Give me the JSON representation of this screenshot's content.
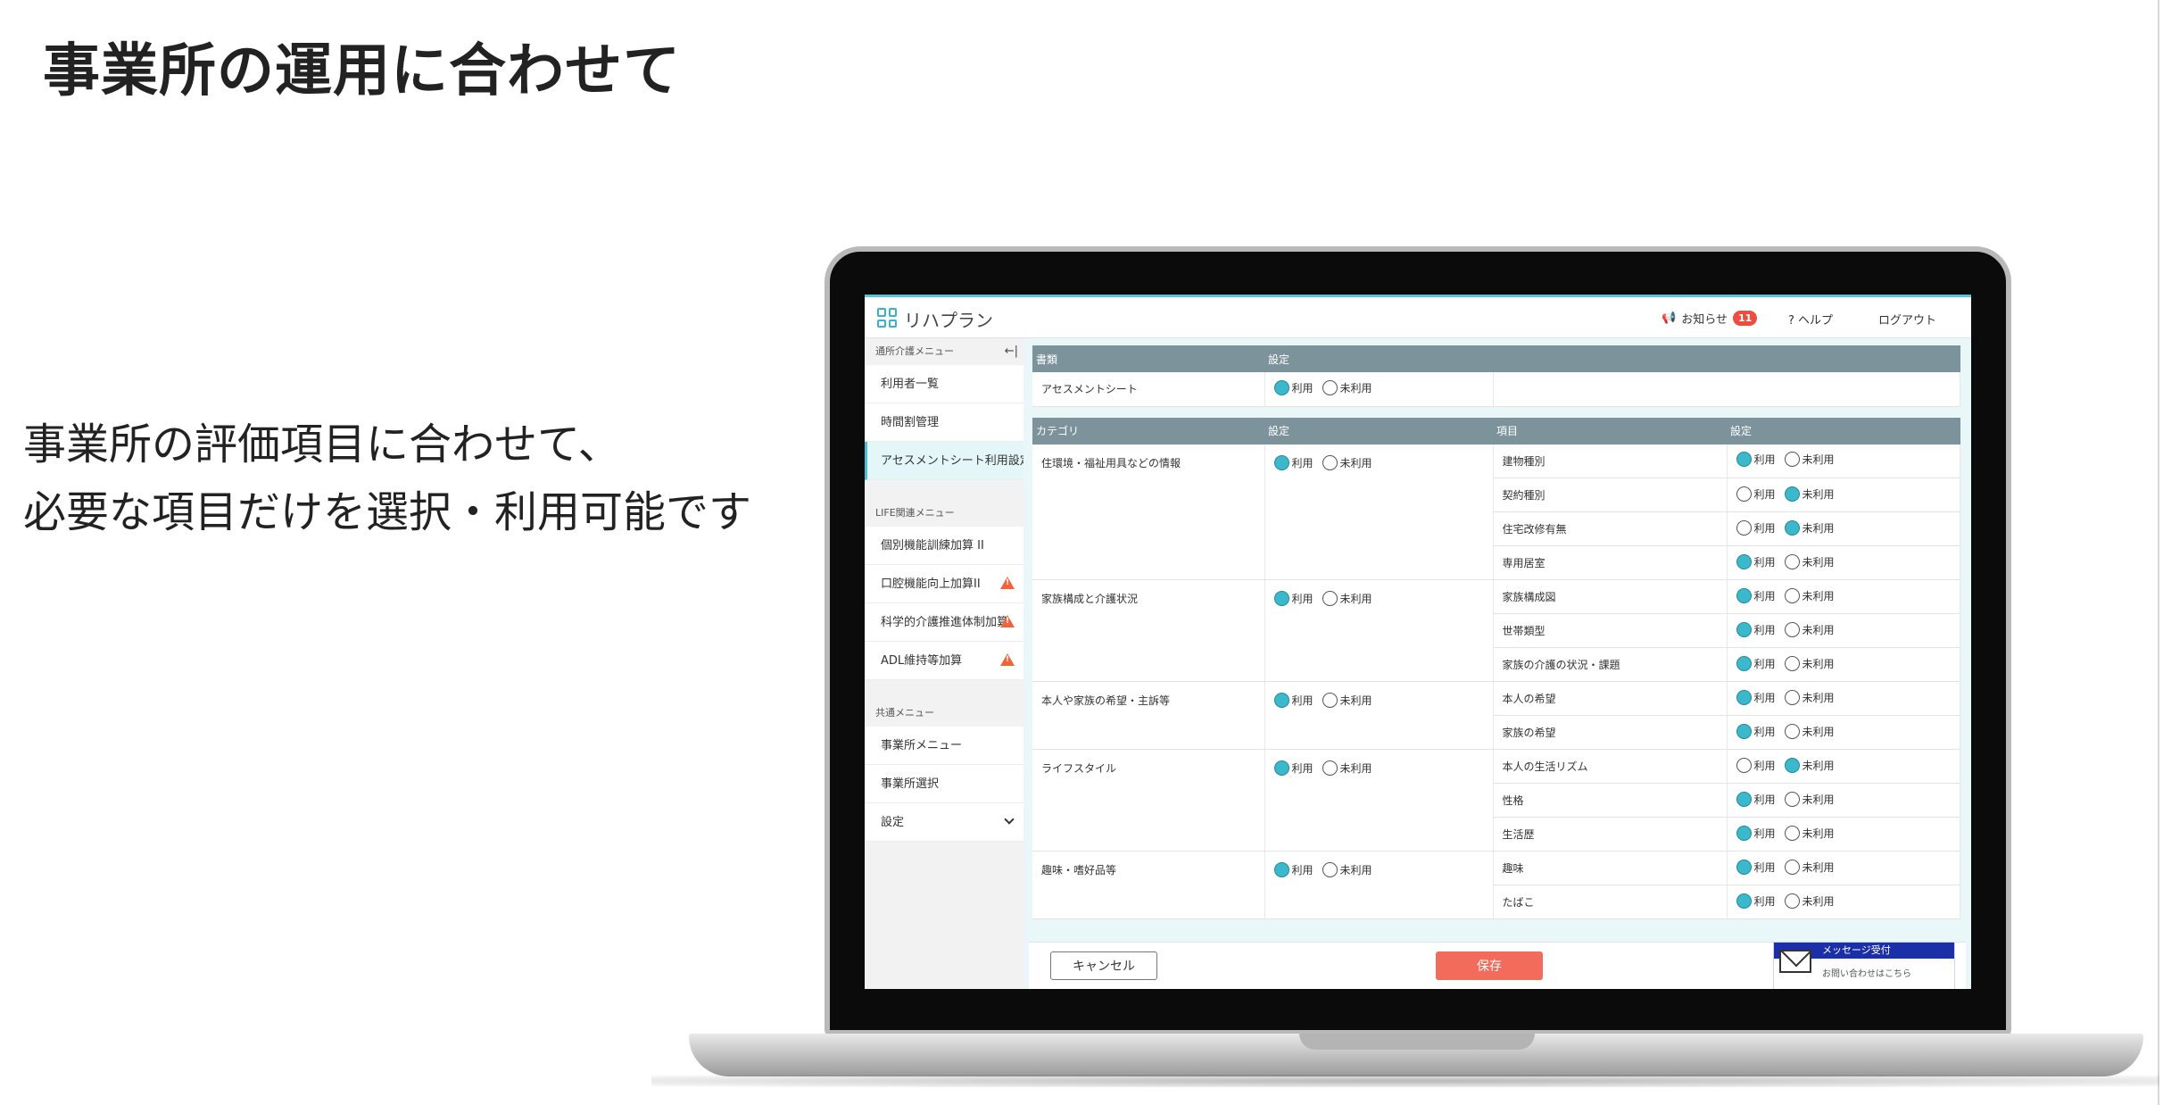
{
  "slide": {
    "title": "事業所の運用に合わせて",
    "desc_line1": "事業所の評価項目に合わせて、",
    "desc_line2": "必要な項目だけを選択・利用可能です"
  },
  "app": {
    "logo_text": "リハプラン",
    "header": {
      "notice_label": "お知らせ",
      "notice_count": "11",
      "help_label": "ヘルプ",
      "logout_label": "ログアウト"
    }
  },
  "sidebar": {
    "section1": "通所介護メニュー",
    "collapse_glyph": "←|",
    "items1": [
      "利用者一覧",
      "時間割管理",
      "アセスメントシート利用設定"
    ],
    "section2": "LIFE関連メニュー",
    "items2": [
      "個別機能訓練加算 II",
      "口腔機能向上加算II",
      "科学的介護推進体制加算",
      "ADL維持等加算"
    ],
    "section3": "共通メニュー",
    "items3": [
      "事業所メニュー",
      "事業所選択",
      "設定"
    ]
  },
  "table1": {
    "headers": [
      "書類",
      "設定"
    ],
    "row": {
      "name": "アセスメントシート",
      "use": true
    }
  },
  "table2": {
    "headers": [
      "カテゴリ",
      "設定",
      "項目",
      "設定"
    ],
    "categories": [
      {
        "name": "住環境・福祉用具などの情報",
        "use": true,
        "items": [
          {
            "name": "建物種別",
            "use": true
          },
          {
            "name": "契約種別",
            "use": false
          },
          {
            "name": "住宅改修有無",
            "use": false
          },
          {
            "name": "専用居室",
            "use": true
          }
        ]
      },
      {
        "name": "家族構成と介護状況",
        "use": true,
        "items": [
          {
            "name": "家族構成図",
            "use": true
          },
          {
            "name": "世帯類型",
            "use": true
          },
          {
            "name": "家族の介護の状況・課題",
            "use": true
          }
        ]
      },
      {
        "name": "本人や家族の希望・主訴等",
        "use": true,
        "items": [
          {
            "name": "本人の希望",
            "use": true
          },
          {
            "name": "家族の希望",
            "use": true
          }
        ]
      },
      {
        "name": "ライフスタイル",
        "use": true,
        "items": [
          {
            "name": "本人の生活リズム",
            "use": false
          },
          {
            "name": "性格",
            "use": true
          },
          {
            "name": "生活歴",
            "use": true
          }
        ]
      },
      {
        "name": "趣味・嗜好品等",
        "use": true,
        "items": [
          {
            "name": "趣味",
            "use": true
          },
          {
            "name": "たばこ",
            "use": true
          }
        ]
      }
    ]
  },
  "radio_labels": {
    "use": "利用",
    "nouse": "未利用"
  },
  "footer": {
    "cancel": "キャンセル",
    "save": "保存"
  },
  "message_widget": {
    "title": "メッセージ受付",
    "subtitle": "お問い合わせはこちら"
  },
  "colors": {
    "accent": "#3bb8cc",
    "header_bg": "#7d939c",
    "save": "#f26b5b",
    "badge": "#ef4b3f",
    "widget": "#1b2fa8"
  }
}
